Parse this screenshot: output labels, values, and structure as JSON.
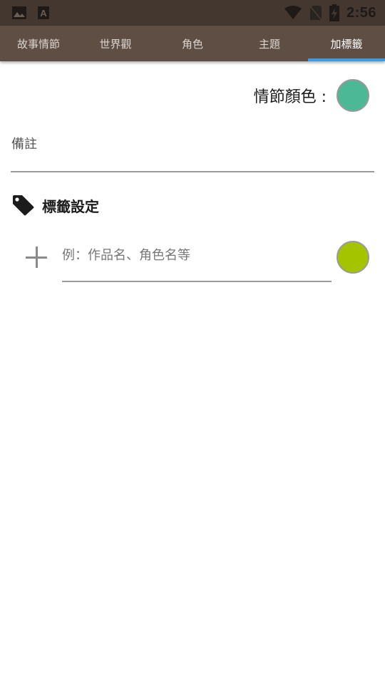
{
  "status_bar": {
    "time": "2:56",
    "icons": [
      "image-icon",
      "text-a-icon",
      "wifi-icon",
      "no-sim-icon",
      "battery-charging-icon"
    ]
  },
  "tabs": [
    {
      "label": "故事情節",
      "active": false
    },
    {
      "label": "世界觀",
      "active": false
    },
    {
      "label": "角色",
      "active": false
    },
    {
      "label": "主題",
      "active": false
    },
    {
      "label": "加標籤",
      "active": true
    }
  ],
  "plot_color": {
    "label": "情節顏色 :",
    "color": "#4db896"
  },
  "note": {
    "label": "備註",
    "value": ""
  },
  "tag_settings": {
    "title": "標籤設定",
    "input_placeholder": "例：作品名、角色名等",
    "input_value": "",
    "tag_color": "#a4c400"
  },
  "colors": {
    "status_bar": "#433730",
    "tab_bar": "#5e4e44",
    "tab_indicator": "#3b9be0"
  }
}
